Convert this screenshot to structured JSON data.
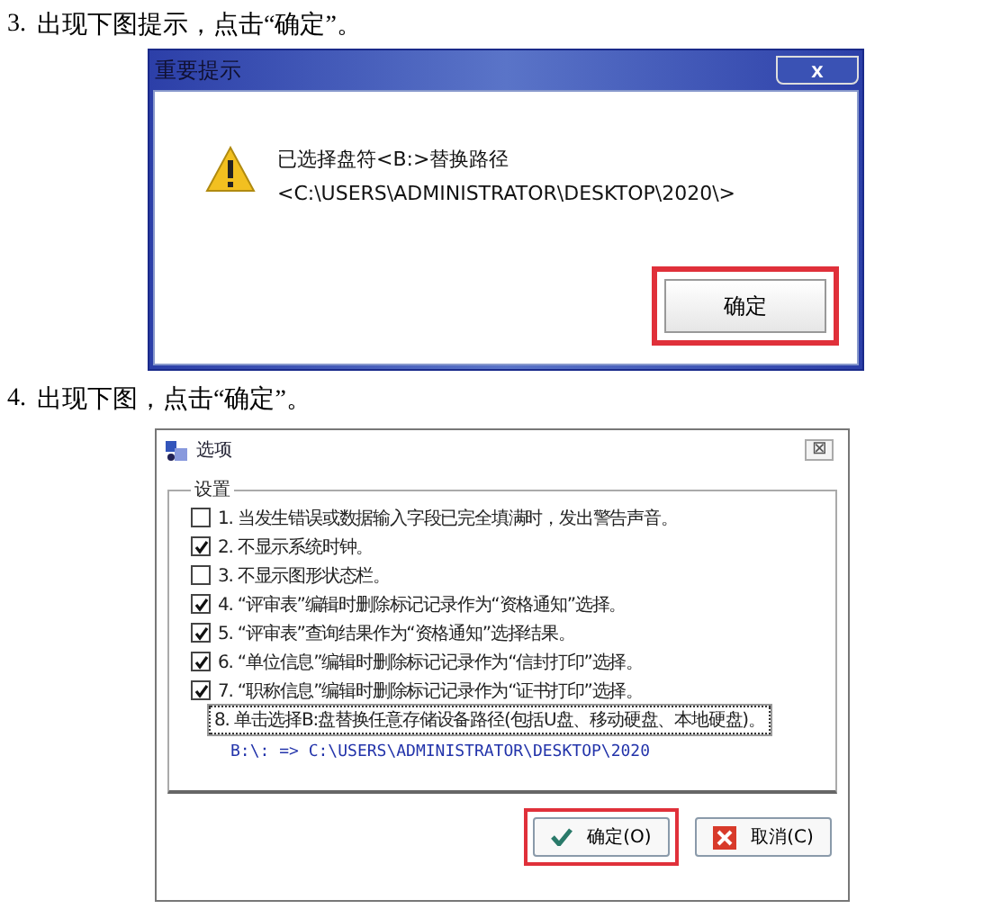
{
  "steps": [
    {
      "number": "3.",
      "text": "出现下图提示，点击“确定”。",
      "dialog": {
        "kind": "alert",
        "title": "重要提示",
        "close": "x",
        "message": [
          "已选择盘符<B:>替换路径",
          "<C:\\USERS\\ADMINISTRATOR\\DESKTOP\\2020\\>"
        ],
        "buttons": [
          {
            "label": "确定",
            "highlighted": true
          }
        ]
      }
    },
    {
      "number": "4.",
      "text": "出现下图，点击“确定”。",
      "dialog": {
        "kind": "options",
        "title": "选项",
        "close": "⊠",
        "group": "设置",
        "options": [
          {
            "kind": "checkbox",
            "label": "1. 当发生错误或数据输入字段已完全填满时，发出警告声音。",
            "checked": false
          },
          {
            "kind": "checkbox",
            "label": "2. 不显示系统时钟。",
            "checked": true
          },
          {
            "kind": "checkbox",
            "label": "3. 不显示图形状态栏。",
            "checked": false
          },
          {
            "kind": "checkbox",
            "label": "4. “评审表”编辑时删除标记记录作为“资格通知”选择。",
            "checked": true
          },
          {
            "kind": "checkbox",
            "label": "5. “评审表”查询结果作为“资格通知”选择结果。",
            "checked": true
          },
          {
            "kind": "checkbox",
            "label": "6. “单位信息”编辑时删除标记记录作为“信封打印”选择。",
            "checked": true
          },
          {
            "kind": "checkbox",
            "label": "7. “职称信息”编辑时删除标记记录作为“证书打印”选择。",
            "checked": true
          },
          {
            "kind": "action",
            "label": "8. 单击选择B:盘替换任意存储设备路径(包括U盘、移动硬盘、本地硬盘)。"
          },
          {
            "kind": "path",
            "label": "B:\\: => C:\\USERS\\ADMINISTRATOR\\DESKTOP\\2020"
          }
        ],
        "buttons": [
          {
            "kind": "ok",
            "label": "确定(O)",
            "highlighted": true
          },
          {
            "kind": "cancel",
            "label": "取消(C)",
            "highlighted": false
          }
        ]
      }
    }
  ]
}
